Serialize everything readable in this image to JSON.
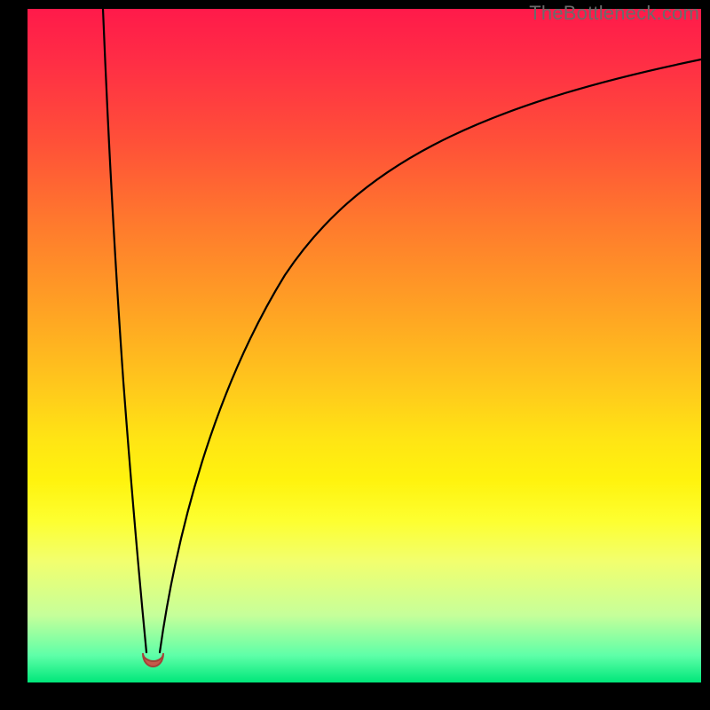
{
  "watermark": "TheBottleneck.com",
  "colors": {
    "frame": "#000000",
    "gradient_top": "#ff1a4a",
    "gradient_bottom": "#00e77a",
    "curve_stroke": "#000000",
    "bump_fill": "#c55a4a",
    "bump_stroke": "#a44238"
  },
  "chart_data": {
    "type": "line",
    "title": "",
    "xlabel": "",
    "ylabel": "",
    "xlim": [
      0,
      100
    ],
    "ylim": [
      0,
      100
    ],
    "note": "x and y are percentage coordinates of the plot area; y=0 is the top edge, y=100 is the bottom edge. Higher y means lower on the visible gradient (closer to green).",
    "series": [
      {
        "name": "left-branch",
        "x": [
          11.2,
          11.9,
          12.8,
          13.9,
          15.2,
          16.7,
          17.7
        ],
        "y": [
          0,
          15,
          32,
          50,
          68,
          85,
          95.5
        ]
      },
      {
        "name": "right-branch",
        "x": [
          19.6,
          21.0,
          23.0,
          26.0,
          30.0,
          35.0,
          41.0,
          48.0,
          56.0,
          65.0,
          75.0,
          86.0,
          100.0
        ],
        "y": [
          95.5,
          88,
          78,
          66,
          54,
          44,
          35,
          28,
          22,
          17,
          13,
          10,
          7.5
        ]
      }
    ],
    "annotations": [
      {
        "name": "bump",
        "shape": "u-shape",
        "cx": 18.6,
        "cy": 97.3,
        "w": 3.2,
        "h": 2.8
      }
    ]
  }
}
